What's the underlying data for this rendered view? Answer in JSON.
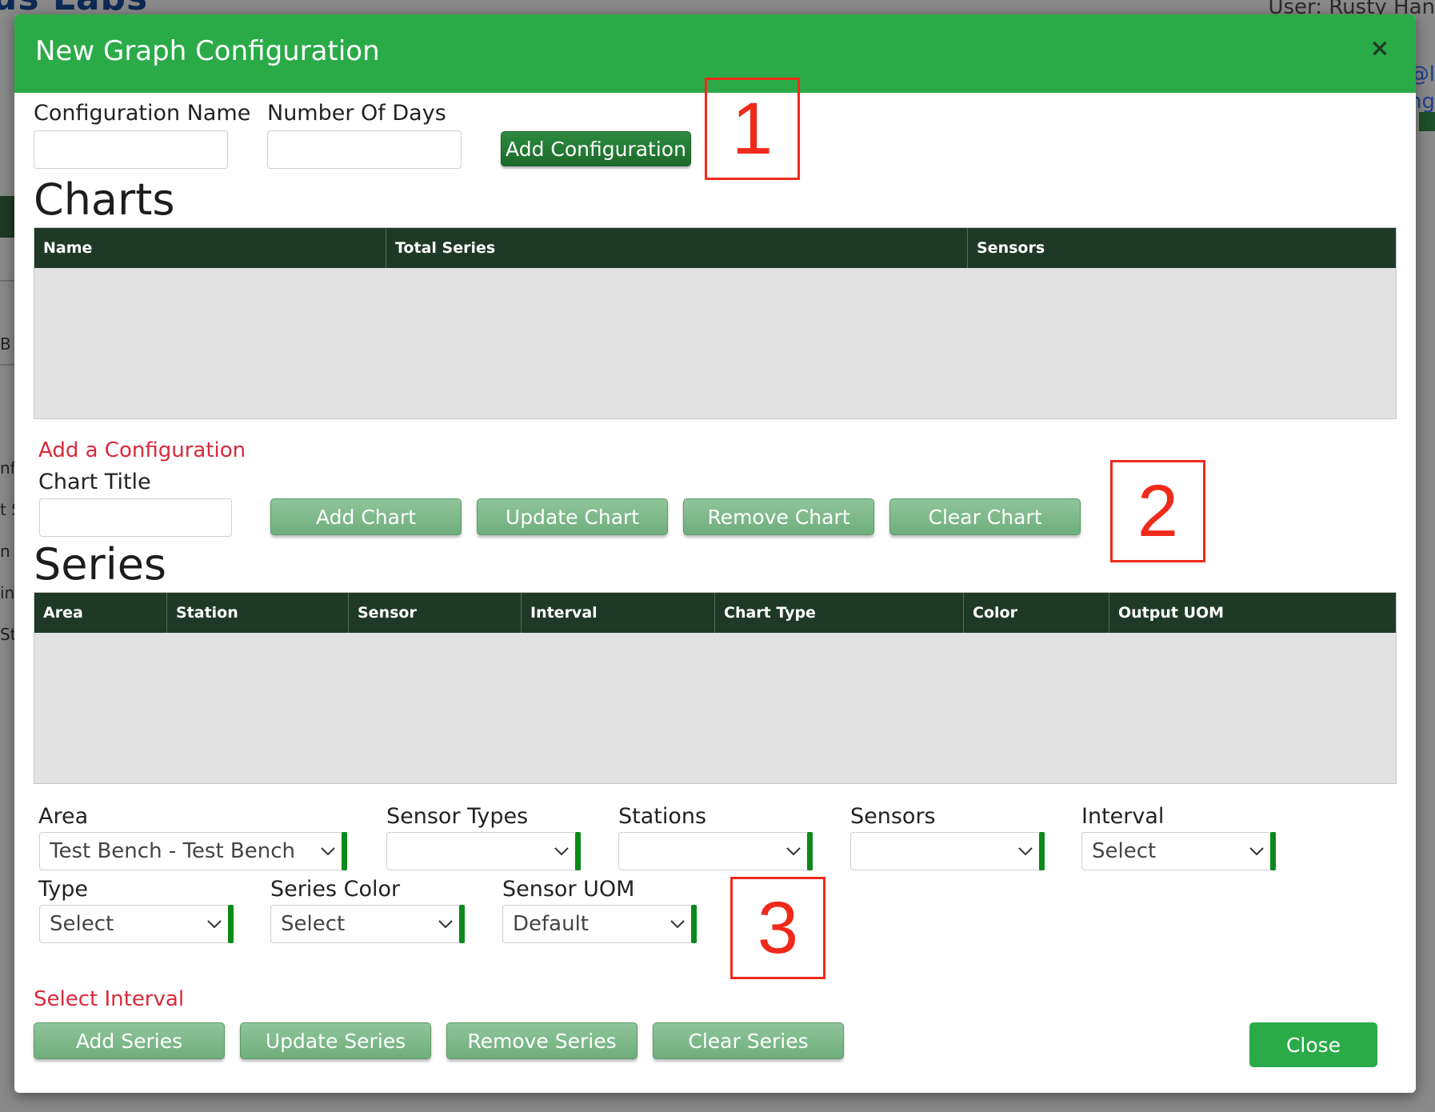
{
  "background": {
    "brand_fragment": "us Labs",
    "user_fragment": "User: Rusty Han",
    "link_fragment_1": "@l",
    "link_fragment_2": "ng",
    "left_fragments": [
      "B",
      "nfi",
      "t S",
      "n",
      "in",
      "St"
    ]
  },
  "modal": {
    "title": "New Graph Configuration",
    "close_icon": "×",
    "config_name_label": "Configuration Name",
    "config_name_value": "",
    "days_label": "Number Of Days",
    "days_value": "",
    "add_configuration_label": "Add Configuration"
  },
  "charts": {
    "title": "Charts",
    "columns": [
      "Name",
      "Total Series",
      "Sensors"
    ],
    "rows": [],
    "status_text": "Add a Configuration",
    "chart_title_label": "Chart Title",
    "chart_title_value": "",
    "buttons": [
      "Add Chart",
      "Update Chart",
      "Remove Chart",
      "Clear Chart"
    ]
  },
  "series": {
    "title": "Series",
    "columns": [
      "Area",
      "Station",
      "Sensor",
      "Interval",
      "Chart Type",
      "Color",
      "Output UOM"
    ],
    "rows": []
  },
  "filters": {
    "area_label": "Area",
    "area_value": "Test Bench - Test Bench",
    "sensor_types_label": "Sensor Types",
    "sensor_types_value": "",
    "stations_label": "Stations",
    "stations_value": "",
    "sensors_label": "Sensors",
    "sensors_value": "",
    "interval_label": "Interval",
    "interval_value": "Select",
    "type_label": "Type",
    "type_value": "Select",
    "series_color_label": "Series Color",
    "series_color_value": "Select",
    "sensor_uom_label": "Sensor UOM",
    "sensor_uom_value": "Default"
  },
  "status": {
    "message": "Select Interval"
  },
  "series_buttons": [
    "Add Series",
    "Update Series",
    "Remove Series",
    "Clear Series"
  ],
  "close_label": "Close",
  "annotations": [
    "1",
    "2",
    "3"
  ],
  "colors": {
    "header_green": "#2bab48",
    "grid_header": "#1e3a27",
    "error_red": "#d9293b",
    "annotation_red": "#ef2a1b"
  }
}
